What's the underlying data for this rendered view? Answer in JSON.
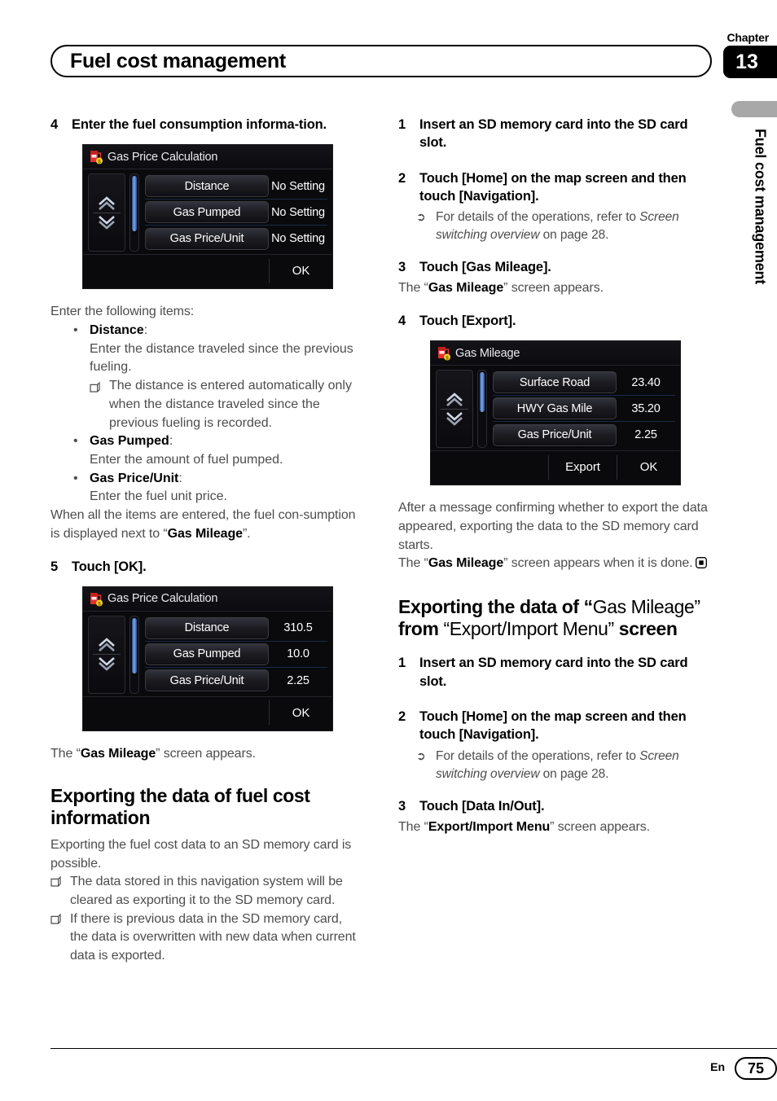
{
  "header": {
    "chapter_label": "Chapter",
    "chapter_number": "13",
    "title": "Fuel cost management",
    "margin_title": "Fuel cost management"
  },
  "footer": {
    "language": "En",
    "page_number": "75"
  },
  "left_column": {
    "step4": {
      "num": "4",
      "text": "Enter the fuel consumption informa-tion."
    },
    "screen_gas_price_empty": {
      "title": "Gas Price Calculation",
      "icon": "gas-pump-icon",
      "rows": [
        {
          "label": "Distance",
          "value": "No Setting"
        },
        {
          "label": "Gas Pumped",
          "value": "No Setting"
        },
        {
          "label": "Gas Price/Unit",
          "value": "No Setting"
        }
      ],
      "footer_buttons": [
        "OK"
      ]
    },
    "intro": "Enter the following items:",
    "bullets": [
      {
        "term": "Distance",
        "desc": "Enter the distance traveled since the previous fueling.",
        "note": "The distance is entered automatically only when the distance traveled since the previous fueling is recorded."
      },
      {
        "term": "Gas Pumped",
        "desc": "Enter the amount of fuel pumped.",
        "note": ""
      },
      {
        "term": "Gas Price/Unit",
        "desc": "Enter the fuel unit price.",
        "note": ""
      }
    ],
    "after_bullets_1": "When all the items are entered, the fuel con-sumption is displayed next to “",
    "after_bullets_bold": "Gas Mileage",
    "after_bullets_2": "”.",
    "step5": {
      "num": "5",
      "text": "Touch [OK]."
    },
    "screen_gas_price_filled": {
      "title": "Gas Price Calculation",
      "icon": "gas-pump-icon",
      "rows": [
        {
          "label": "Distance",
          "value": "310.5"
        },
        {
          "label": "Gas Pumped",
          "value": "10.0"
        },
        {
          "label": "Gas Price/Unit",
          "value": "2.25"
        }
      ],
      "footer_buttons": [
        "OK"
      ]
    },
    "after_screen5_1": "The “",
    "after_screen5_bold": "Gas Mileage",
    "after_screen5_2": "” screen appears.",
    "section_heading": "Exporting the data of fuel cost information",
    "section_body": "Exporting the fuel cost data to an SD memory card is possible.",
    "section_notes": [
      "The data stored in this navigation system will be cleared as exporting it to the SD memory card.",
      "If there is previous data in the SD memory card, the data is overwritten with new data when current data is exported."
    ]
  },
  "right_column": {
    "step1": {
      "num": "1",
      "text": "Insert an SD memory card into the SD card slot."
    },
    "step2": {
      "num": "2",
      "text": "Touch [Home] on the map screen and then touch [Navigation]."
    },
    "step2_ref_pre": "For details of the operations, refer to ",
    "step2_ref_italic": "Screen switching overview",
    "step2_ref_post": " on page 28.",
    "step3": {
      "num": "3",
      "text": "Touch [Gas Mileage]."
    },
    "step3_body_pre": "The “",
    "step3_body_bold": "Gas Mileage",
    "step3_body_post": "” screen appears.",
    "step4": {
      "num": "4",
      "text": "Touch [Export]."
    },
    "screen_gas_mileage": {
      "title": "Gas Mileage",
      "icon": "gas-pump-icon",
      "rows": [
        {
          "label": "Surface Road",
          "value": "23.40"
        },
        {
          "label": "HWY Gas Mile",
          "value": "35.20"
        },
        {
          "label": "Gas Price/Unit",
          "value": "2.25"
        }
      ],
      "footer_buttons": [
        "Export",
        "OK"
      ]
    },
    "after_screen_1": "After a message confirming whether to export the data appeared, exporting the data to the SD memory card starts.",
    "after_screen_2_pre": "The “",
    "after_screen_2_bold": "Gas Mileage",
    "after_screen_2_post": "” screen appears when it is done.",
    "section_heading_parts": {
      "p1": "Exporting the data of “",
      "p2": "Gas Mileage” ",
      "p3": "from ",
      "p4": "“Export/Import Menu” ",
      "p5": "screen"
    },
    "s2_step1": {
      "num": "1",
      "text": "Insert an SD memory card into the SD card slot."
    },
    "s2_step2": {
      "num": "2",
      "text": "Touch [Home] on the map screen and then touch [Navigation]."
    },
    "s2_ref_pre": "For details of the operations, refer to ",
    "s2_ref_italic": "Screen switching overview",
    "s2_ref_post": " on page 28.",
    "s2_step3": {
      "num": "3",
      "text": "Touch [Data In/Out]."
    },
    "s2_body_pre": "The “",
    "s2_body_bold": "Export/Import Menu",
    "s2_body_post": "” screen appears."
  },
  "colors": {
    "ink": "#231f20",
    "body_gray": "#4d4d4d",
    "device_bg": "#0a0a0c",
    "accent_blue": "#7ea6e8",
    "pump_red": "#e03030",
    "pump_yellow": "#f5d020",
    "margin_tab_gray": "#a8a8a8"
  }
}
